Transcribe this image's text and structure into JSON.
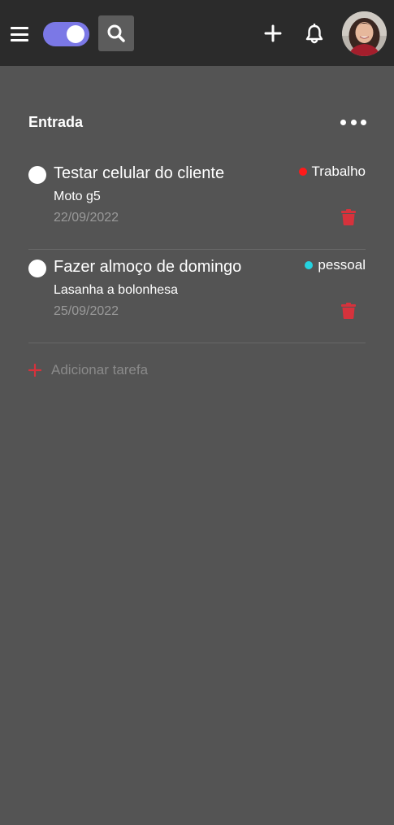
{
  "header": {
    "menu_icon": "hamburger-menu-icon",
    "toggle": {
      "state": "on",
      "color": "#7b78e6"
    },
    "search_icon": "search-icon",
    "add_icon": "plus-icon",
    "notification_icon": "bell-icon",
    "avatar": "user-avatar"
  },
  "section": {
    "title": "Entrada",
    "more_icon": "more-options-icon"
  },
  "tasks": [
    {
      "title": "Testar celular do cliente",
      "description": "Moto g5",
      "date": "22/09/2022",
      "tag": "Trabalho",
      "tag_color": "#ff1a1a",
      "delete_icon": "trash-icon"
    },
    {
      "title": "Fazer almoço de domingo",
      "description": "Lasanha a bolonhesa",
      "date": "25/09/2022",
      "tag": "pessoal",
      "tag_color": "#25d3e0",
      "delete_icon": "trash-icon"
    }
  ],
  "add_task": {
    "label": "Adicionar tarefa",
    "icon": "plus-icon",
    "icon_color": "#d6323c"
  },
  "colors": {
    "background": "#545454",
    "topbar": "#2b2b2b",
    "accent_red": "#d6323c"
  }
}
